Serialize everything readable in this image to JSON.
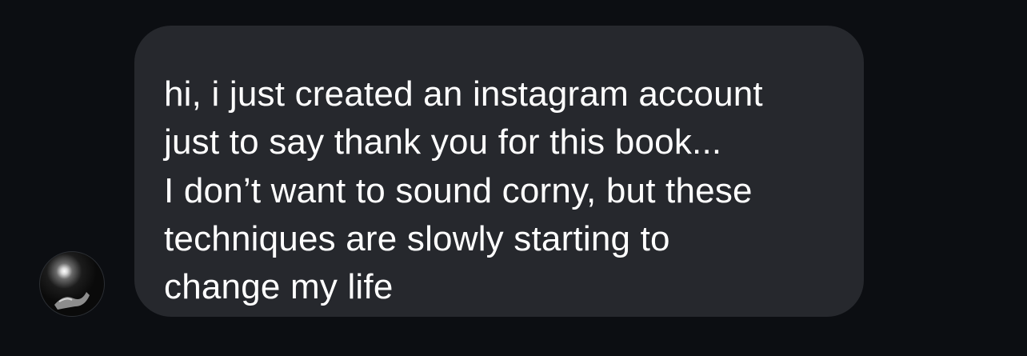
{
  "conversation": {
    "sender_avatar_icon": "user-avatar-icon",
    "message": {
      "paragraphs": [
        {
          "lines": [
            "hi, i just created an instagram account",
            "just to say thank you for this book..."
          ]
        },
        {
          "lines": [
            "I don’t want to sound corny, but these",
            "techniques are slowly starting to",
            "change my life"
          ]
        }
      ]
    }
  },
  "colors": {
    "background": "#0c0e12",
    "bubble": "#26282d",
    "text": "#ffffff"
  }
}
